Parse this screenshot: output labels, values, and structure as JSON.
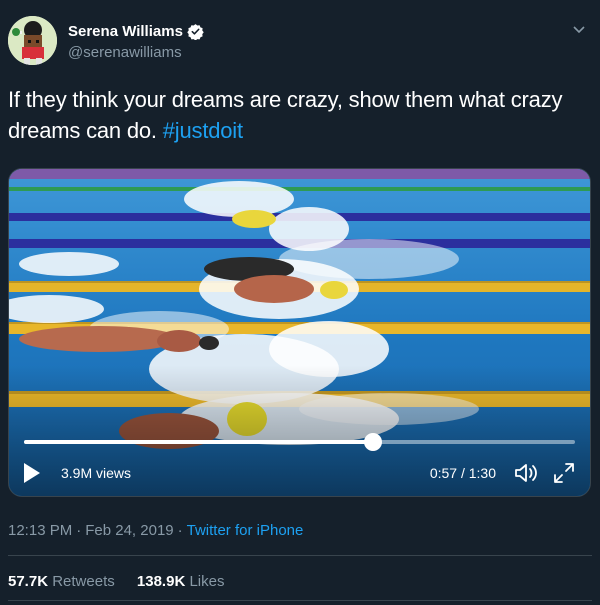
{
  "user": {
    "display_name": "Serena Williams",
    "handle": "@serenawilliams",
    "verified": true
  },
  "tweet": {
    "text": "If they think your dreams are crazy, show them what crazy dreams can do.",
    "hashtag": "#justdoit"
  },
  "video": {
    "views": "3.9M views",
    "timecode": "0:57 / 1:30",
    "progress": 0.633
  },
  "meta": {
    "time": "12:13 PM",
    "date": "Feb 24, 2019",
    "separator": "·",
    "source": "Twitter for iPhone"
  },
  "stats": {
    "retweets_count": "57.7K",
    "retweets_label": "Retweets",
    "likes_count": "138.9K",
    "likes_label": "Likes"
  },
  "colors": {
    "background": "#15202b",
    "accent": "#1da1f2",
    "secondary_text": "#8899a6",
    "divider": "#38444d"
  },
  "icons": [
    "verified-badge-icon",
    "chevron-down-icon",
    "play-icon",
    "volume-icon",
    "fullscreen-icon"
  ]
}
